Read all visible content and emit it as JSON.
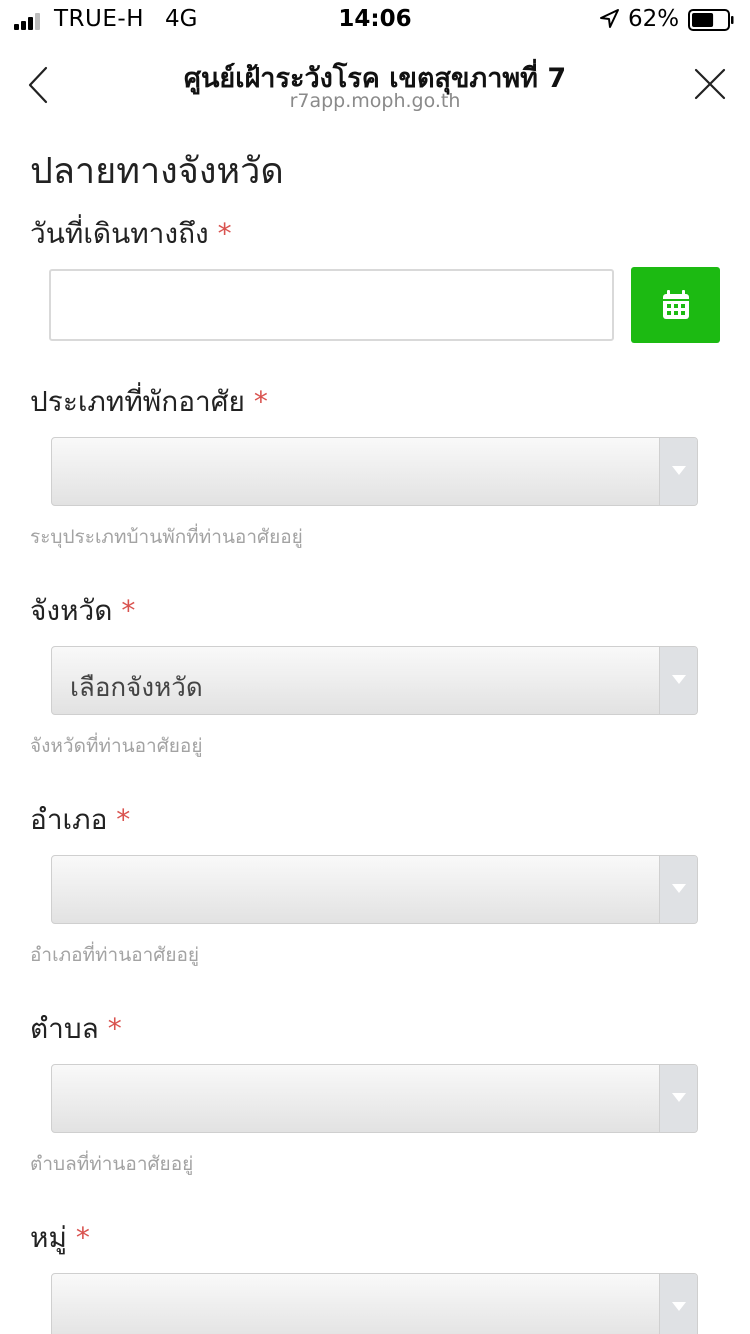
{
  "status_bar": {
    "carrier": "TRUE-H",
    "network": "4G",
    "time": "14:06",
    "battery": "62%",
    "battery_level": 0.62
  },
  "header": {
    "title": "ศูนย์เฝ้าระวังโรค เขตสุขภาพที่ 7",
    "url": "r7app.moph.go.th",
    "back_icon": "chevron-left-icon",
    "close_icon": "close-icon"
  },
  "form": {
    "section_title": "ปลายทางจังหวัด",
    "required_mark": "*",
    "arrival_date": {
      "label": "วันที่เดินทางถึง",
      "value": "",
      "button_icon": "calendar-icon"
    },
    "accommodation_type": {
      "label": "ประเภทที่พักอาศัย",
      "value": "",
      "hint": "ระบุประเภทบ้านพักที่ท่านอาศัยอยู่"
    },
    "province": {
      "label": "จังหวัด",
      "value": "เลือกจังหวัด",
      "hint": "จังหวัดที่ท่านอาศัยอยู่"
    },
    "district": {
      "label": "อำเภอ",
      "value": "",
      "hint": "อำเภอที่ท่านอาศัยอยู่"
    },
    "subdistrict": {
      "label": "ตำบล",
      "value": "",
      "hint": "ตำบลที่ท่านอาศัยอยู่"
    },
    "village": {
      "label": "หมู่",
      "value": ""
    }
  },
  "colors": {
    "accent_green": "#1cba12",
    "required_red": "#d9534f",
    "hint_gray": "#a3a3a3"
  }
}
